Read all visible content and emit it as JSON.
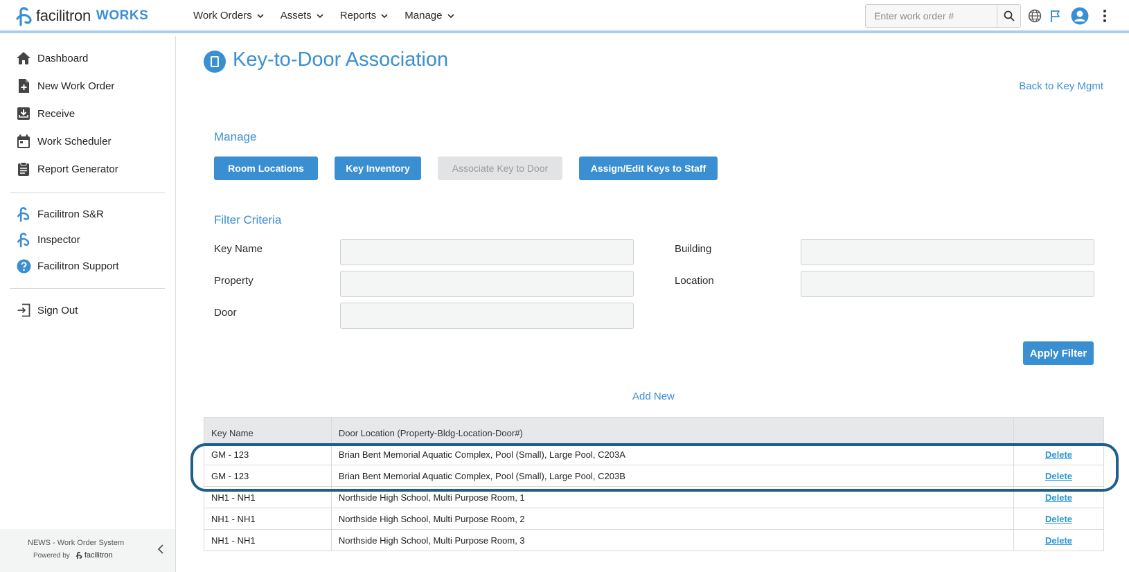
{
  "header": {
    "brand": "facilitron",
    "brand_suffix": "WORKS",
    "nav": [
      {
        "label": "Work Orders"
      },
      {
        "label": "Assets"
      },
      {
        "label": "Reports"
      },
      {
        "label": "Manage"
      }
    ],
    "search": {
      "placeholder": "Enter work order #"
    },
    "icons": [
      "search-icon",
      "globe-icon",
      "flag-icon",
      "user-avatar-icon",
      "more-vertical-icon"
    ]
  },
  "sidebar": {
    "items": [
      {
        "label": "Dashboard",
        "icon": "home-icon"
      },
      {
        "label": "New Work Order",
        "icon": "new-document-icon"
      },
      {
        "label": "Receive",
        "icon": "inbox-download-icon"
      },
      {
        "label": "Work Scheduler",
        "icon": "calendar-icon"
      },
      {
        "label": "Report Generator",
        "icon": "clipboard-icon"
      }
    ],
    "apps": [
      {
        "label": "Facilitron S&R",
        "icon": "facilitron-logo-icon"
      },
      {
        "label": "Inspector",
        "icon": "facilitron-logo-icon"
      },
      {
        "label": "Facilitron Support",
        "icon": "help-circle-icon"
      }
    ],
    "signout": {
      "label": "Sign Out",
      "icon": "sign-out-icon"
    },
    "footer": {
      "system_name": "NEWS - Work Order System",
      "powered_by": "Powered by",
      "powered_brand": "facilitron"
    }
  },
  "main": {
    "title": "Key-to-Door Association",
    "back_link": "Back to Key Mgmt",
    "manage_heading": "Manage",
    "manage_buttons": [
      {
        "label": "Room Locations",
        "state": "active"
      },
      {
        "label": "Key Inventory",
        "state": "active"
      },
      {
        "label": "Associate Key to Door",
        "state": "disabled"
      },
      {
        "label": "Assign/Edit Keys to Staff",
        "state": "active"
      }
    ],
    "filter_heading": "Filter Criteria",
    "filters": {
      "key_name": {
        "label": "Key Name",
        "value": ""
      },
      "building": {
        "label": "Building",
        "value": ""
      },
      "property": {
        "label": "Property",
        "value": ""
      },
      "location": {
        "label": "Location",
        "value": ""
      },
      "door": {
        "label": "Door",
        "value": ""
      }
    },
    "apply_filter": "Apply Filter",
    "add_new": "Add New",
    "table": {
      "columns": [
        "Key Name",
        "Door Location (Property-Bldg-Location-Door#)",
        ""
      ],
      "rows": [
        {
          "key": "GM - 123",
          "location": "Brian Bent Memorial Aquatic Complex, Pool (Small), Large Pool, C203A",
          "action": "Delete"
        },
        {
          "key": "GM - 123",
          "location": "Brian Bent Memorial Aquatic Complex, Pool (Small), Large Pool, C203B",
          "action": "Delete"
        },
        {
          "key": "NH1 - NH1",
          "location": "Northside High School, Multi Purpose Room, 1",
          "action": "Delete"
        },
        {
          "key": "NH1 - NH1",
          "location": "Northside High School, Multi Purpose Room, 2",
          "action": "Delete"
        },
        {
          "key": "NH1 - NH1",
          "location": "Northside High School, Multi Purpose Room, 3",
          "action": "Delete"
        }
      ]
    }
  },
  "colors": {
    "accent": "#3a8fd3",
    "highlight_ring": "#1f5f8b",
    "disabled_bg": "#e2e3e4"
  }
}
